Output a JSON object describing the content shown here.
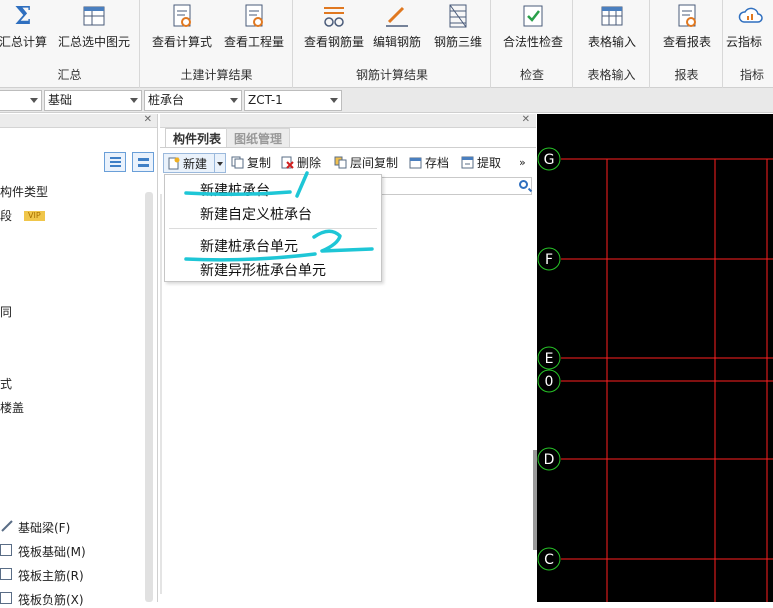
{
  "ribbon": {
    "groups": [
      {
        "title": "汇总",
        "buttons": [
          "汇总计算",
          "汇总选中图元"
        ]
      },
      {
        "title": "土建计算结果",
        "buttons": [
          "查看计算式",
          "查看工程量"
        ]
      },
      {
        "title": "钢筋计算结果",
        "buttons": [
          "查看钢筋量",
          "编辑钢筋",
          "钢筋三维"
        ]
      },
      {
        "title": "检查",
        "buttons": [
          "合法性检查"
        ]
      },
      {
        "title": "表格输入",
        "buttons": [
          "表格输入"
        ]
      },
      {
        "title": "报表",
        "buttons": [
          "查看报表"
        ]
      },
      {
        "title": "指标",
        "buttons": [
          "云指标"
        ]
      }
    ]
  },
  "selectors": {
    "floor": "",
    "category": "基础",
    "type": "桩承台",
    "component": "ZCT-1"
  },
  "nav": {
    "items": [
      "构件类型",
      "段",
      "VIP",
      "同",
      "式",
      "楼盖"
    ],
    "tree": [
      "基础梁(F)",
      "筏板基础(M)",
      "筏板主筋(R)",
      "筏板负筋(X)"
    ]
  },
  "list_panel": {
    "tabs": [
      "构件列表",
      "图纸管理"
    ],
    "toolbar": [
      "新建",
      "复制",
      "删除",
      "层间复制",
      "存档",
      "提取"
    ],
    "more": "»"
  },
  "menu": {
    "items": [
      "新建桩承台",
      "新建自定义桩承台",
      "新建桩承台单元",
      "新建异形桩承台单元"
    ]
  },
  "annotations": {
    "one": "1",
    "two": "2"
  },
  "axes": {
    "labels": [
      "G",
      "F",
      "E",
      "0",
      "D",
      "C"
    ]
  },
  "colors": {
    "grid": "#ff2020",
    "axis_circle": "#27c427",
    "canvas": "#000000"
  }
}
